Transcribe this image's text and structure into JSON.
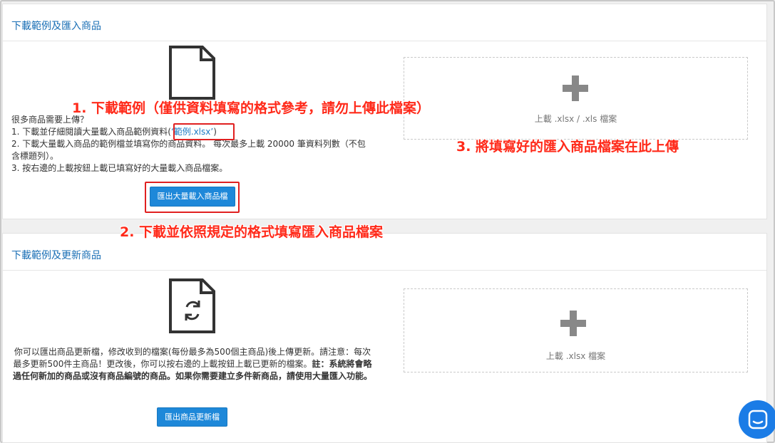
{
  "import_section": {
    "title": "下載範例及匯入商品",
    "desc_line1": "很多商品需要上傳？",
    "desc_line2_pre": "1. 下載並仔細閱讀大量載入商品範例資料",
    "sample_open": "(",
    "sample_link": "‘範例.xlsx’",
    "sample_close": ")",
    "desc_line3": "2. 下載大量載入商品的範例檔並填寫你的商品資料。 每次最多上載 20000 筆資料列數（不包含標題列）。",
    "desc_line4": "3. 按右邊的上載按鈕上載已填寫好的大量載入商品檔案。",
    "export_button": "匯出大量載入商品檔",
    "upload_label": "上載 .xlsx / .xls 檔案"
  },
  "update_section": {
    "title": "下載範例及更新商品",
    "desc_normal": "你可以匯出商品更新檔，修改收到的檔案(每份最多為500個主商品)後上傳更新。請注意：每次最多更新500件主商品！更改後，你可以按右邊的上載按鈕上載已更新的檔案。",
    "desc_bold": "註：系統將會略過任何新加的商品或沒有商品編號的商品。如果你需要建立多件新商品，請使用大量匯入功能。",
    "export_button": "匯出商品更新檔",
    "upload_label": "上載 .xlsx 檔案"
  },
  "annotations": {
    "step1": "1. 下載範例（僅供資料填寫的格式參考，請勿上傳此檔案）",
    "step2": "2. 下載並依照規定的格式填寫匯入商品檔案",
    "step3": "3. 將填寫好的匯入商品檔案在此上傳"
  },
  "icons": {
    "document": "document-icon",
    "document_refresh": "document-refresh-icon",
    "plus": "plus-icon",
    "chat": "chat-icon"
  },
  "colors": {
    "accent": "#1e88d9",
    "title": "#1a6fb5",
    "annotation": "#ff2a1a",
    "chat": "#1b7ce6"
  }
}
